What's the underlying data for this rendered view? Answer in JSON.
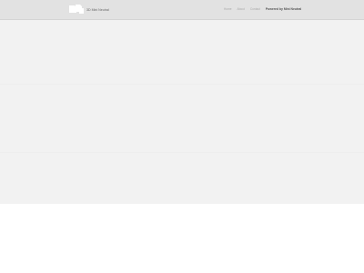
{
  "header": {
    "logo_icon": "brand-logo-icon",
    "brand_text": "3D Mini Neutral",
    "nav": {
      "items": [
        {
          "label": "Home"
        },
        {
          "label": "About"
        },
        {
          "label": "Contact"
        }
      ],
      "active_label": "Powered by Mini Neutral"
    }
  },
  "colors": {
    "header_bg": "#e2e2e2",
    "hero_bg": "#f2f2f2",
    "page_bg": "#ffffff",
    "brand_text": "#666666"
  }
}
